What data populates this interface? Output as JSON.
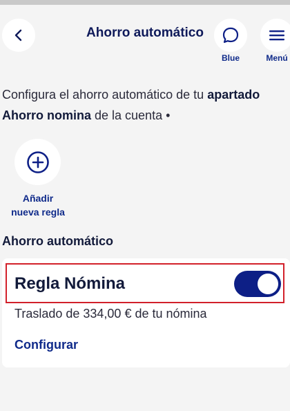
{
  "header": {
    "title": "Ahorro automático",
    "chat_label": "Blue",
    "menu_label": "Menú"
  },
  "intro": {
    "part1": "Configura el ahorro automático de tu ",
    "bold1": "apartado Ahorro nomina",
    "part2": " de la cuenta •"
  },
  "add_rule": {
    "line1": "Añadir",
    "line2": "nueva regla"
  },
  "section": {
    "title": "Ahorro automático"
  },
  "rule": {
    "name": "Regla Nómina",
    "enabled": true,
    "description": "Traslado de 334,00 € de tu nómina",
    "configure_label": "Configurar"
  },
  "colors": {
    "accent": "#0d1f86",
    "highlight_border": "#d2202a",
    "background": "#f4f4f4"
  }
}
